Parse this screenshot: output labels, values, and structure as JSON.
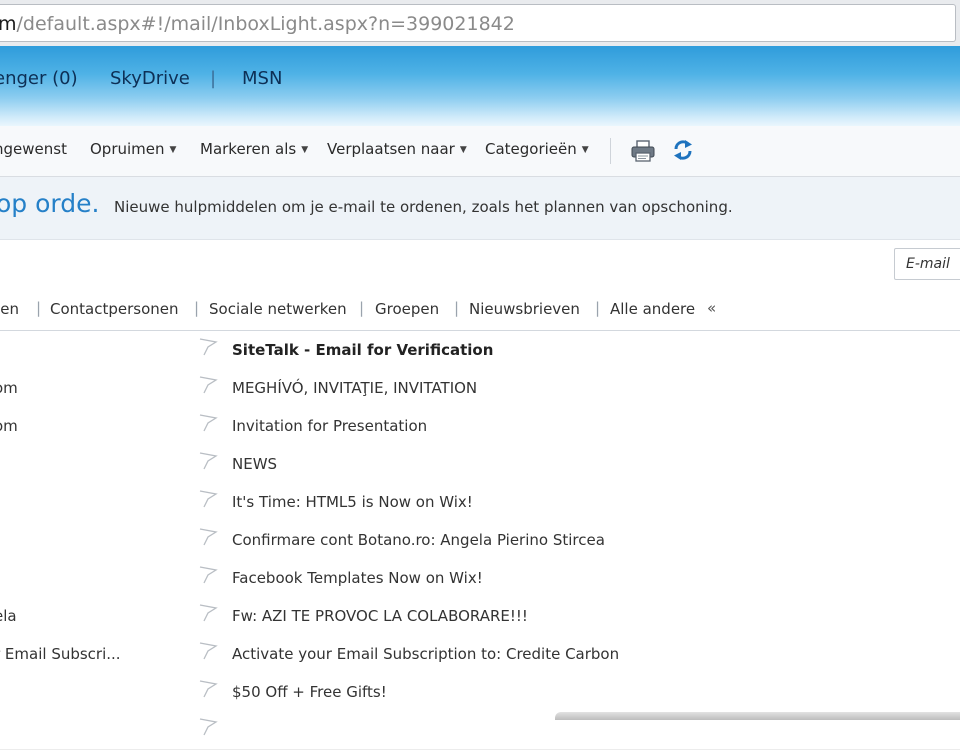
{
  "address_bar": {
    "url_host": "m",
    "url_path": "/default.aspx#!/mail/InboxLight.aspx?n=399021842"
  },
  "header": {
    "links": [
      "enger (0)",
      "SkyDrive",
      "MSN"
    ],
    "separator": "|"
  },
  "toolbar": {
    "items": [
      "ngewenst",
      "Opruimen",
      "Markeren als",
      "Verplaatsen naar",
      "Categorieën"
    ],
    "dropdown_arrow": "▼",
    "icons": [
      "print-icon",
      "refresh-icon"
    ],
    "icon_color": "#1e73be"
  },
  "banner": {
    "title": "op orde.",
    "text": "Nieuwe hulpmiddelen om je e-mail te ordenen, zoals het plannen van opschoning.",
    "title_color": "#2580c8"
  },
  "search": {
    "placeholder": "E-mail"
  },
  "filters": {
    "items": [
      "cen",
      "Contactpersonen",
      "Sociale netwerken",
      "Groepen",
      "Nieuwsbrieven",
      "Alle andere"
    ],
    "separator": "|",
    "collapse": "«"
  },
  "messages": [
    {
      "sender": "",
      "subject": "SiteTalk - Email for Verification",
      "unread": true
    },
    {
      "sender": "om",
      "subject": "MEGHÍVÓ, INVITAŢIE, INVITATION",
      "unread": false
    },
    {
      "sender": "om",
      "subject": "Invitation for Presentation",
      "unread": false
    },
    {
      "sender": "",
      "subject": "NEWS",
      "unread": false
    },
    {
      "sender": "",
      "subject": "It's Time: HTML5 is Now on Wix!",
      "unread": false
    },
    {
      "sender": "",
      "subject": "Confirmare cont Botano.ro: Angela Pierino Stircea",
      "unread": false
    },
    {
      "sender": "",
      "subject": "Facebook Templates Now on Wix!",
      "unread": false
    },
    {
      "sender": "ela",
      "subject": "Fw: AZI TE PROVOC LA COLABORARE!!!",
      "unread": false
    },
    {
      "sender": "r Email Subscri...",
      "subject": "Activate your Email Subscription to: Credite Carbon",
      "unread": false
    },
    {
      "sender": "",
      "subject": "$50 Off + Free Gifts!",
      "unread": false
    },
    {
      "sender": "",
      "subject": "",
      "unread": false
    }
  ]
}
